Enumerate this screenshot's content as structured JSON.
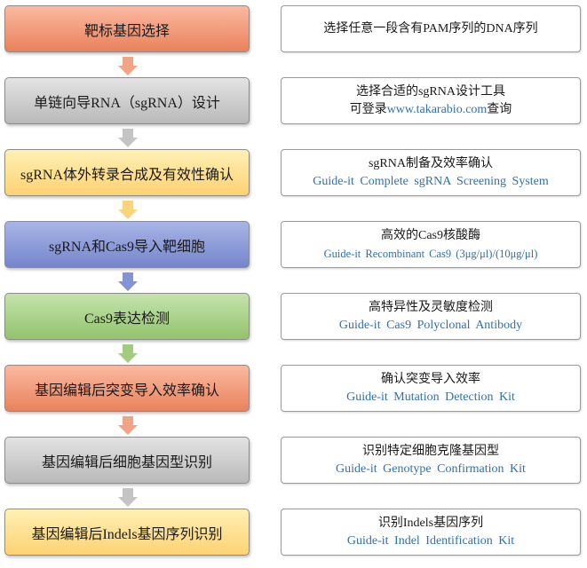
{
  "steps": [
    {
      "label": "靶标基因选择",
      "fill_top": "#fbb9a1",
      "fill_bottom": "#e9825c",
      "arrow_color": "#f2a487",
      "desc_line1": "选择任意一段含有PAM序列的DNA序列",
      "desc_line2": ""
    },
    {
      "label": "单链向导RNA（sgRNA）设计",
      "fill_top": "#e3e3e3",
      "fill_bottom": "#b9b9b9",
      "arrow_color": "#c4c4c4",
      "desc_line1": "选择合适的sgRNA设计工具",
      "desc_line2_prefix": "可登录",
      "desc_line2_link": "www.takarabio.com",
      "desc_line2_suffix": "查询"
    },
    {
      "label": "sgRNA体外转录合成及有效性确认",
      "fill_top": "#fff0b4",
      "fill_bottom": "#fcd273",
      "arrow_color": "#fbd57d",
      "desc_line1": "sgRNA制备及效率确认",
      "desc_line2": "Guide-it Complete sgRNA Screening System"
    },
    {
      "label": "sgRNA和Cas9导入靶细胞",
      "fill_top": "#a9b5e6",
      "fill_bottom": "#7485cc",
      "arrow_color": "#8393d6",
      "desc_line1": "高效的Cas9核酸酶",
      "desc_line2": "Guide-it Recombinant Cas9 (3μg/μl)/(10μg/μl)"
    },
    {
      "label": "Cas9表达检测",
      "fill_top": "#c6e2ad",
      "fill_bottom": "#93c46c",
      "arrow_color": "#a2cc80",
      "desc_line1": "高特异性及灵敏度检测",
      "desc_line2": "Guide-it Cas9 Polyclonal Antibody"
    },
    {
      "label": "基因编辑后突变导入效率确认",
      "fill_top": "#fbb9a1",
      "fill_bottom": "#e9825c",
      "arrow_color": "#f2a487",
      "desc_line1": "确认突变导入效率",
      "desc_line2": "Guide-it Mutation Detection Kit"
    },
    {
      "label": "基因编辑后细胞基因型识别",
      "fill_top": "#e3e3e3",
      "fill_bottom": "#b9b9b9",
      "arrow_color": "#c4c4c4",
      "desc_line1": "识别特定细胞克隆基因型",
      "desc_line2": "Guide-it Genotype Confirmation Kit"
    },
    {
      "label": "基因编辑后Indels基因序列识别",
      "fill_top": "#fff0b4",
      "fill_bottom": "#fcd273",
      "desc_line1": "识别Indels基因序列",
      "desc_line2": "Guide-it Indel Identification Kit"
    }
  ]
}
